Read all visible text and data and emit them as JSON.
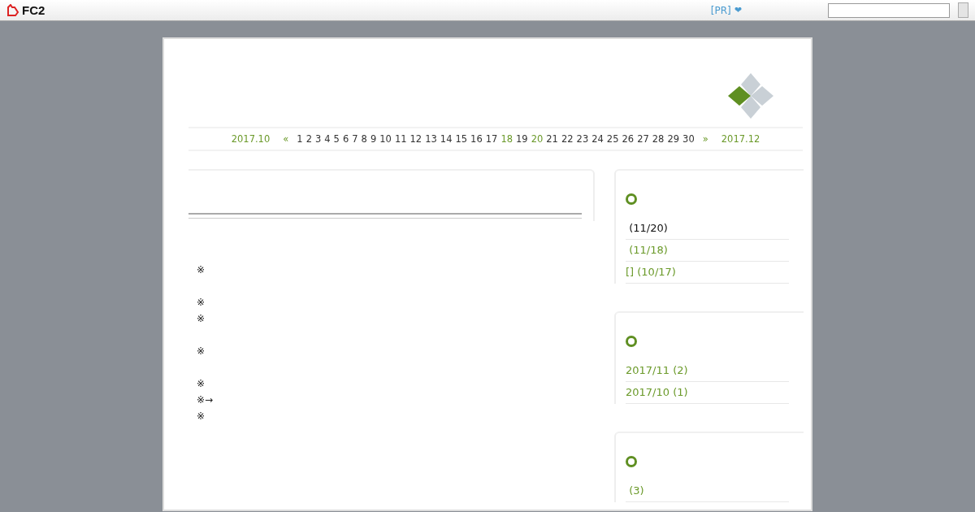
{
  "topbar": {
    "brand": "FC2",
    "pr_link": "[PR]",
    "heart": "❤"
  },
  "calendar": {
    "prev": "2017.10",
    "prev_arrow": "«",
    "next_arrow": "»",
    "next": "2017.12",
    "days": [
      {
        "label": "1",
        "linked": false
      },
      {
        "label": "2",
        "linked": false
      },
      {
        "label": "3",
        "linked": false
      },
      {
        "label": "4",
        "linked": false
      },
      {
        "label": "5",
        "linked": false
      },
      {
        "label": "6",
        "linked": false
      },
      {
        "label": "7",
        "linked": false
      },
      {
        "label": "8",
        "linked": false
      },
      {
        "label": "9",
        "linked": false
      },
      {
        "label": "10",
        "linked": false
      },
      {
        "label": "11",
        "linked": false
      },
      {
        "label": "12",
        "linked": false
      },
      {
        "label": "13",
        "linked": false
      },
      {
        "label": "14",
        "linked": false
      },
      {
        "label": "15",
        "linked": false
      },
      {
        "label": "16",
        "linked": false
      },
      {
        "label": "17",
        "linked": false
      },
      {
        "label": "18",
        "linked": true
      },
      {
        "label": "19",
        "linked": false
      },
      {
        "label": "20",
        "linked": true
      },
      {
        "label": "21",
        "linked": false
      },
      {
        "label": "22",
        "linked": false
      },
      {
        "label": "23",
        "linked": false
      },
      {
        "label": "24",
        "linked": false
      },
      {
        "label": "25",
        "linked": false
      },
      {
        "label": "26",
        "linked": false
      },
      {
        "label": "27",
        "linked": false
      },
      {
        "label": "28",
        "linked": false
      },
      {
        "label": "29",
        "linked": false
      },
      {
        "label": "30",
        "linked": false
      }
    ]
  },
  "article": {
    "paragraphs": [
      [
        "※"
      ],
      [
        "※",
        "※"
      ],
      [
        "※"
      ],
      [
        "※",
        "※→",
        "※"
      ]
    ]
  },
  "sidebar": [
    {
      "items": [
        {
          "label": " (11/20)",
          "selected": true
        },
        {
          "label": " (11/18)",
          "selected": false
        },
        {
          "label": "[] (10/17)",
          "selected": false
        }
      ]
    },
    {
      "items": [
        {
          "label": "2017/11 (2)",
          "selected": false
        },
        {
          "label": "2017/10 (1)",
          "selected": false
        }
      ]
    },
    {
      "items": [
        {
          "label": " (3)",
          "selected": false
        }
      ]
    }
  ]
}
